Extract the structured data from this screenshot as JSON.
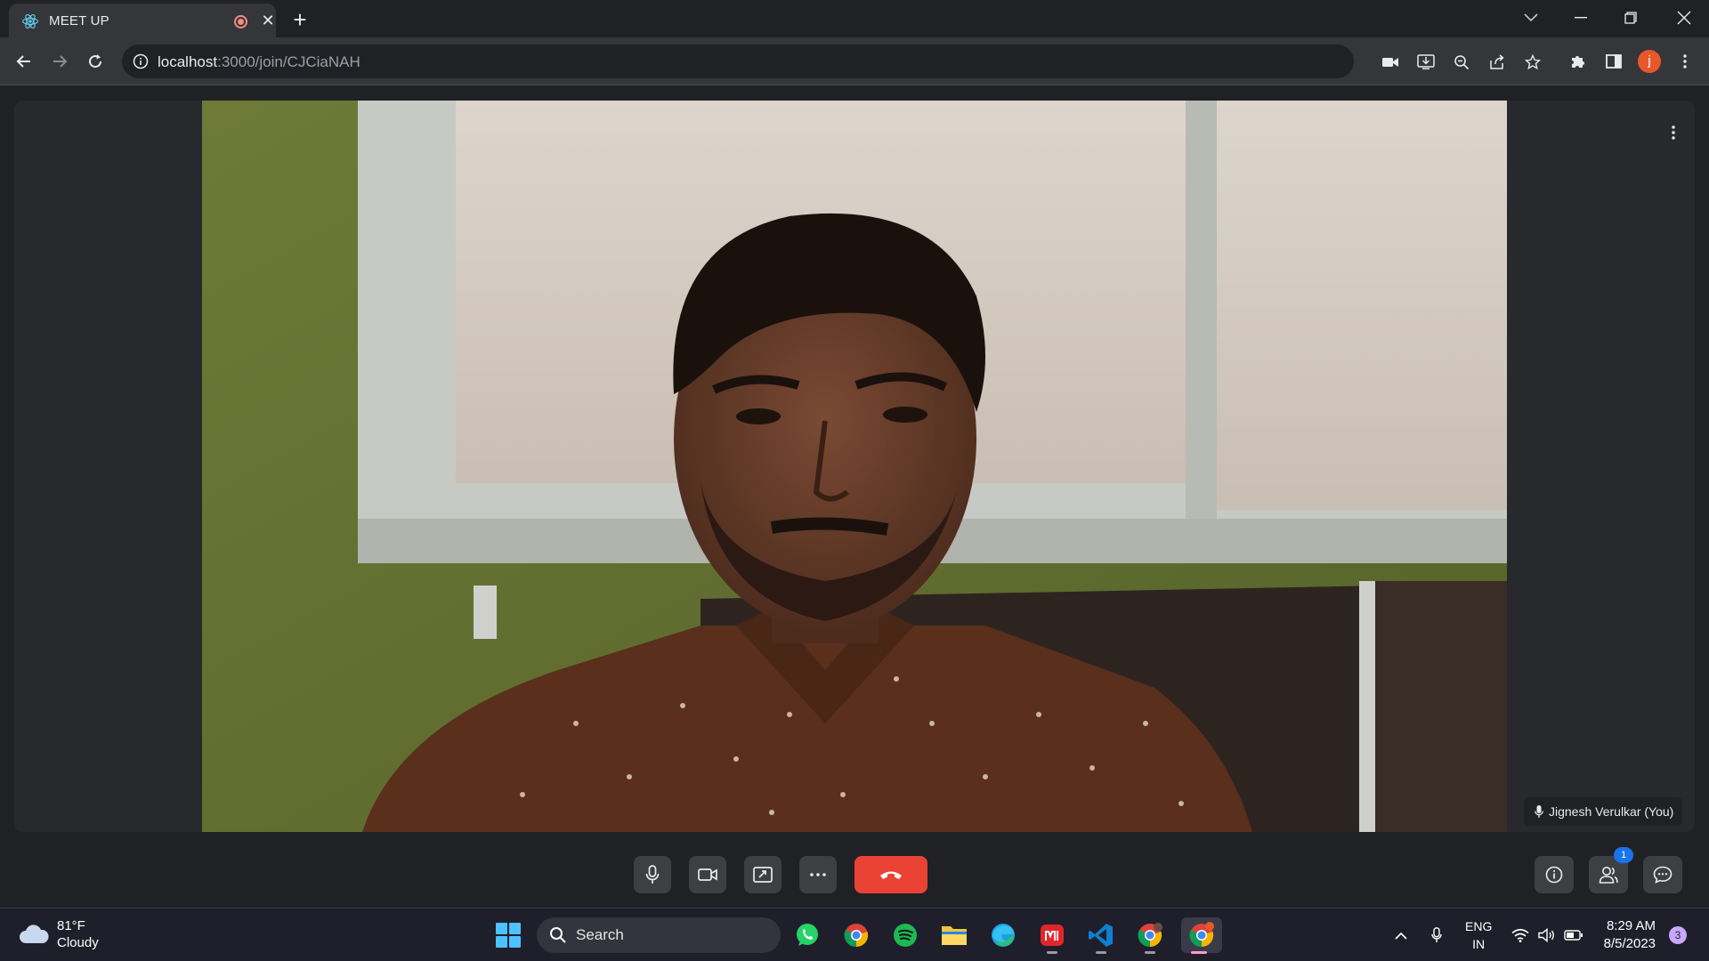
{
  "browser": {
    "tab_title": "MEET UP",
    "url_host": "localhost",
    "url_path": ":3000/join/CJCiaNAH",
    "profile_initial": "j"
  },
  "meeting": {
    "participant_label": "Jignesh Verulkar (You)",
    "participants_badge": "1",
    "controls": [
      "microphone",
      "camera",
      "present-screen",
      "more-options",
      "end-call"
    ],
    "side_controls": [
      "meeting-info",
      "people",
      "chat"
    ],
    "accent_end_call": "#ea4335"
  },
  "taskbar": {
    "weather_temp": "81°F",
    "weather_desc": "Cloudy",
    "search_label": "Search",
    "apps": [
      "whatsapp",
      "chrome",
      "spotify",
      "file-explorer",
      "edge",
      "app-red",
      "vscode",
      "chrome-profile-2",
      "chrome-profile-active"
    ],
    "lang_top": "ENG",
    "lang_bottom": "IN",
    "time": "8:29 AM",
    "date": "8/5/2023",
    "notifications": "3"
  }
}
